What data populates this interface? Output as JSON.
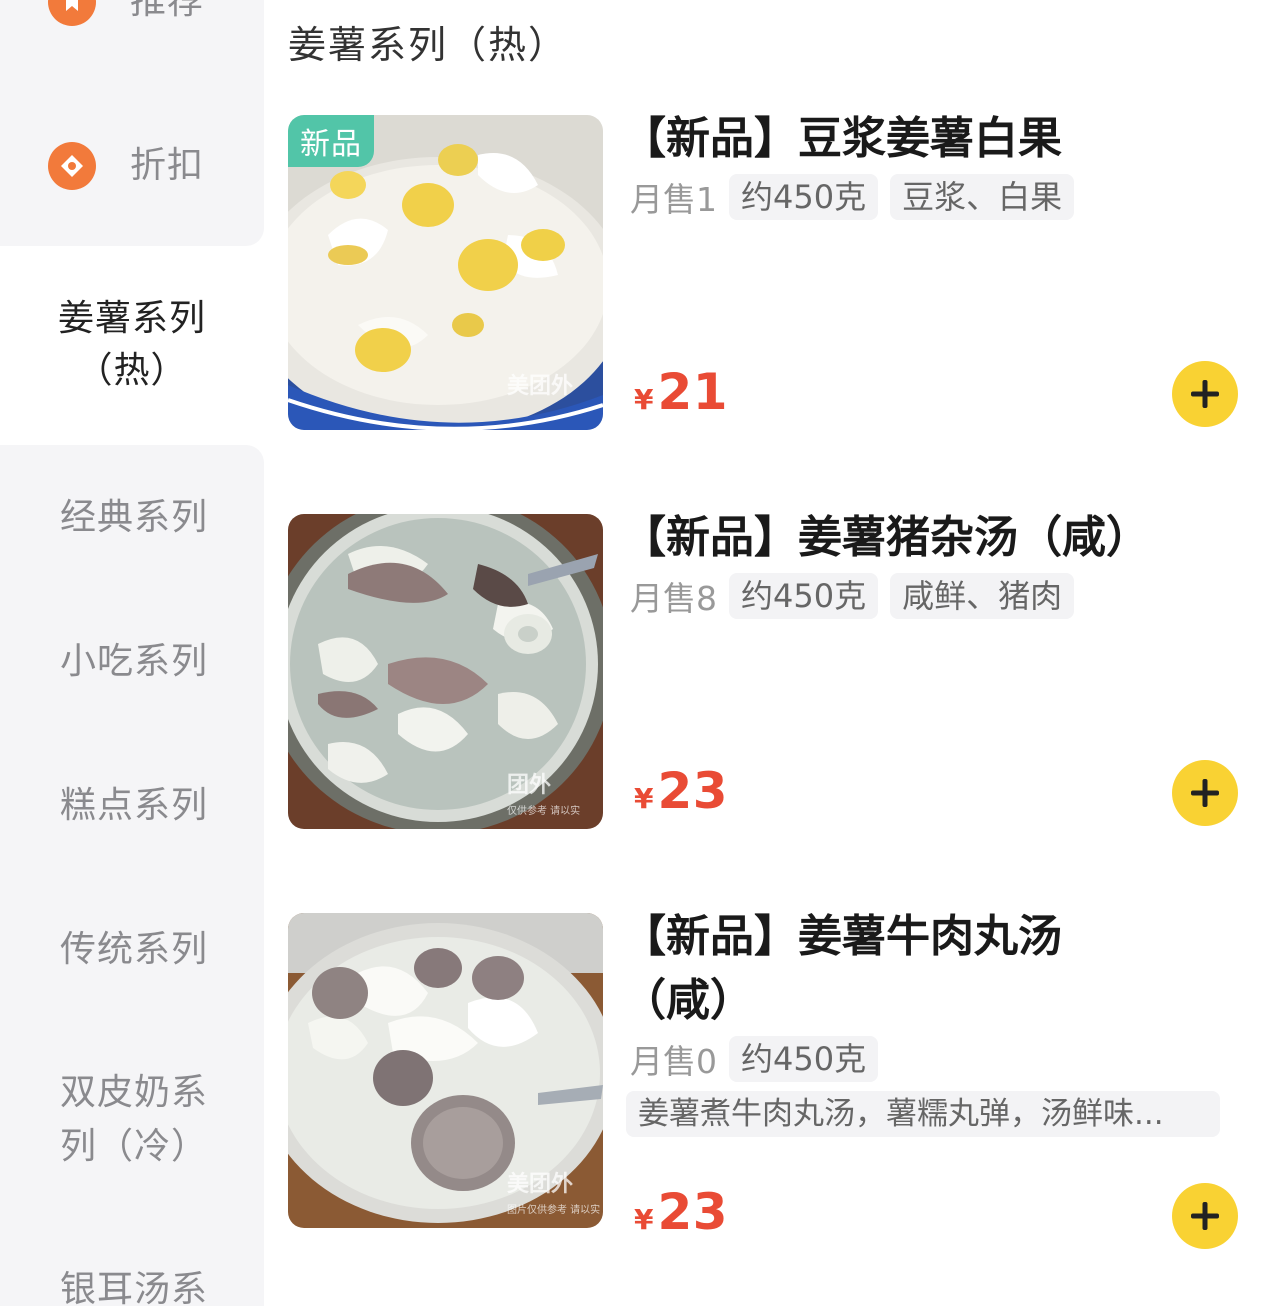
{
  "sidebar": {
    "items": [
      {
        "label": "推荐"
      },
      {
        "label": "折扣"
      },
      {
        "label_line1": "姜薯系列",
        "label_line2": "（热）"
      },
      {
        "label": "经典系列"
      },
      {
        "label": "小吃系列"
      },
      {
        "label": "糕点系列"
      },
      {
        "label": "传统系列"
      },
      {
        "label_line1": "双皮奶系",
        "label_line2": "列（冷）"
      },
      {
        "label": "银耳汤系"
      }
    ],
    "active_index": 2,
    "icon_color": "#f27a3b"
  },
  "section_title": "姜薯系列（热）",
  "products": [
    {
      "name": "【新品】豆浆姜薯白果",
      "tag": "新品",
      "sold": "月售1",
      "chips": [
        "约450克",
        "豆浆、白果"
      ],
      "currency": "¥",
      "price": "21",
      "watermark": "美团外"
    },
    {
      "name": "【新品】姜薯猪杂汤（咸）",
      "sold": "月售8",
      "chips": [
        "约450克",
        "咸鲜、猪肉"
      ],
      "currency": "¥",
      "price": "23",
      "watermark": "团外",
      "watermark_sub": "仅供参考 请以实"
    },
    {
      "name_line1": "【新品】姜薯牛肉丸汤",
      "name_line2": "（咸）",
      "sold": "月售0",
      "chips": [
        "约450克"
      ],
      "description": "姜薯煮牛肉丸汤，薯糯丸弹，汤鲜味...",
      "currency": "¥",
      "price": "23",
      "watermark": "美团外",
      "watermark_sub": "图片仅供参考 请以实"
    }
  ],
  "colors": {
    "accent_price": "#e94b35",
    "add_button": "#f9d233",
    "new_tag": "#52c5a8",
    "sidebar_bg": "#f5f5f7"
  }
}
